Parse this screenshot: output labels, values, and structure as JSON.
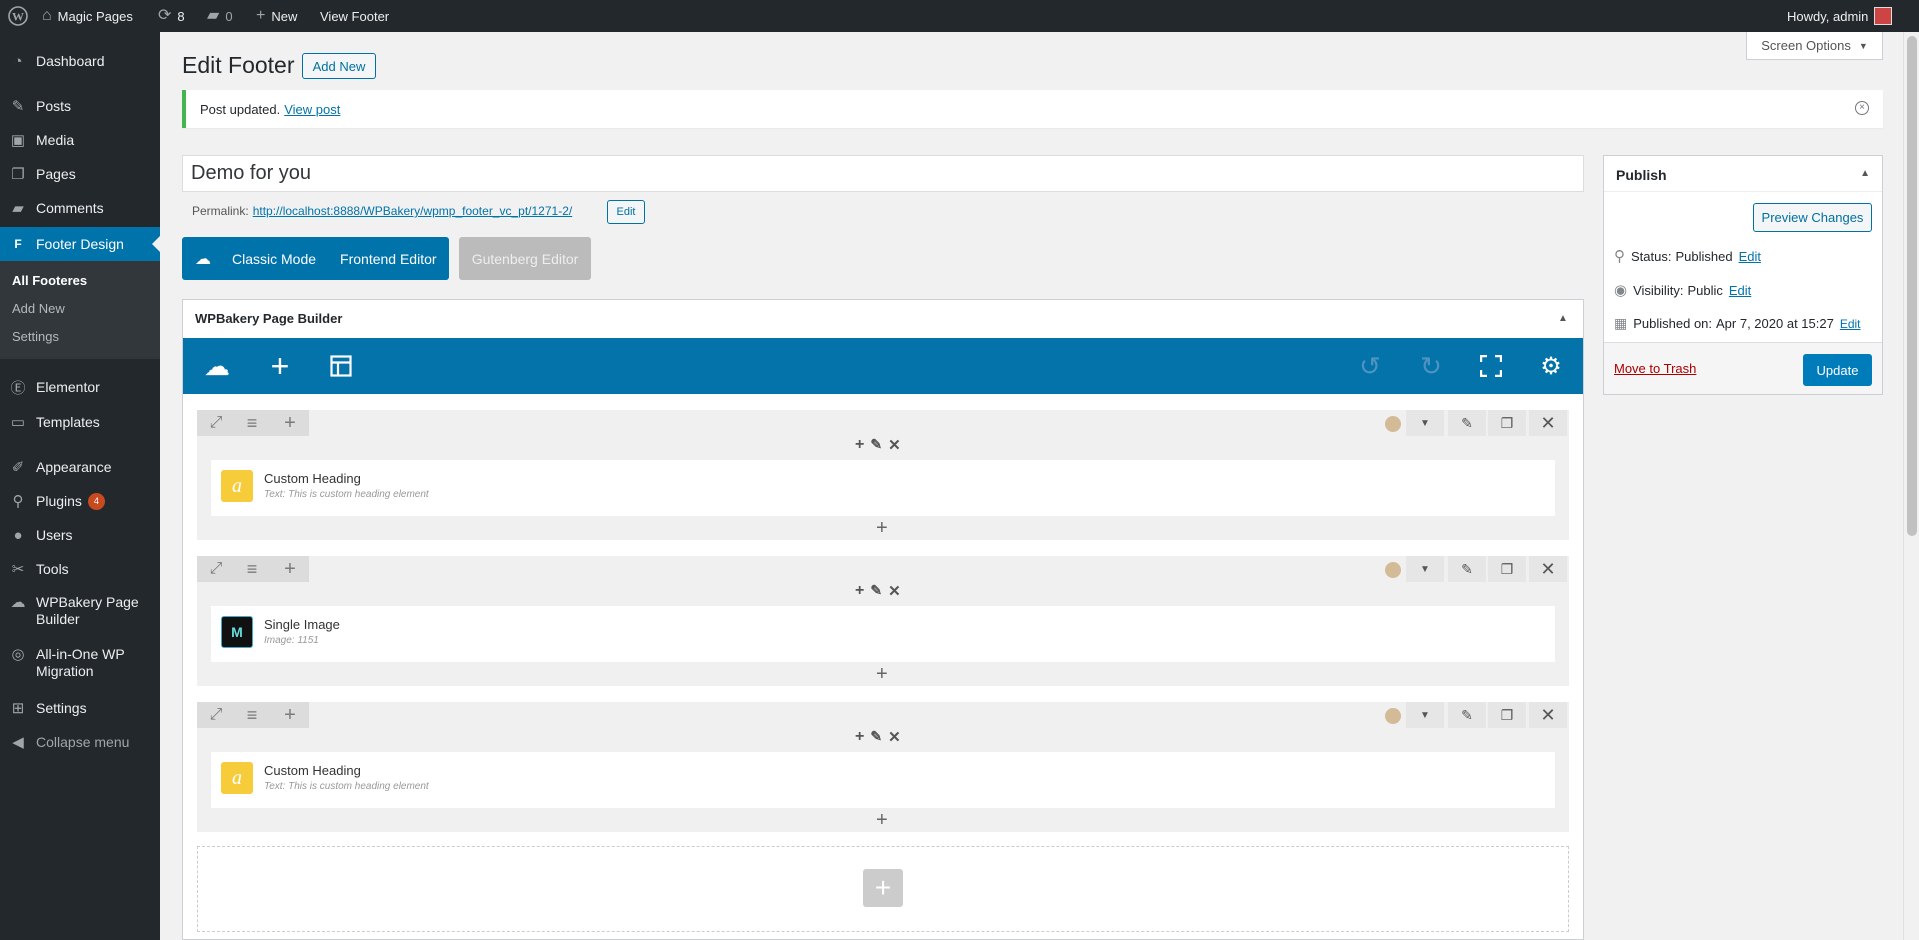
{
  "adminbar": {
    "site_name": "Magic Pages",
    "updates_count": "8",
    "comments_count": "0",
    "new_label": "New",
    "view_label": "View Footer",
    "howdy": "Howdy, admin"
  },
  "sidebar": {
    "items": [
      {
        "label": "Dashboard",
        "icon": "dashboard-icon"
      },
      {
        "label": "Posts",
        "icon": "pin-icon"
      },
      {
        "label": "Media",
        "icon": "media-icon"
      },
      {
        "label": "Pages",
        "icon": "pages-icon"
      },
      {
        "label": "Comments",
        "icon": "comment-icon"
      },
      {
        "label": "Footer Design",
        "icon": "footer-design-icon"
      },
      {
        "label": "Elementor",
        "icon": "elementor-icon"
      },
      {
        "label": "Templates",
        "icon": "folder-icon"
      },
      {
        "label": "Appearance",
        "icon": "brush-icon"
      },
      {
        "label": "Plugins",
        "icon": "plug-icon",
        "badge": "4"
      },
      {
        "label": "Users",
        "icon": "user-icon"
      },
      {
        "label": "Tools",
        "icon": "wrench-icon"
      },
      {
        "label": "WPBakery Page Builder",
        "icon": "cloud-icon"
      },
      {
        "label": "All-in-One WP Migration",
        "icon": "migration-icon"
      },
      {
        "label": "Settings",
        "icon": "settings-icon"
      },
      {
        "label": "Collapse menu",
        "icon": "collapse-icon"
      }
    ],
    "submenu": [
      "All Footeres",
      "Add New",
      "Settings"
    ]
  },
  "header": {
    "title": "Edit Footer",
    "add_new": "Add New",
    "screen_options": "Screen Options"
  },
  "notice": {
    "text": "Post updated.",
    "link": "View post"
  },
  "post": {
    "title": "Demo for you",
    "permalink_label": "Permalink:",
    "permalink_url": "http://localhost:8888/WPBakery/wpmp_footer_vc_pt/1271-2/",
    "permalink_edit": "Edit"
  },
  "editor_buttons": {
    "classic": "Classic Mode",
    "frontend": "Frontend Editor",
    "gutenberg": "Gutenberg Editor"
  },
  "builder": {
    "title": "WPBakery Page Builder",
    "rows": [
      {
        "element_title": "Custom Heading",
        "element_sub": "Text: This is custom heading element",
        "icon": "custom-heading-icon",
        "icon_text": "a"
      },
      {
        "element_title": "Single Image",
        "element_sub": "Image: 1151",
        "icon": "single-image-icon",
        "icon_text": ""
      },
      {
        "element_title": "Custom Heading",
        "element_sub": "Text: This is custom heading element",
        "icon": "custom-heading-icon",
        "icon_text": "a"
      }
    ]
  },
  "publish": {
    "title": "Publish",
    "preview": "Preview Changes",
    "status_label": "Status:",
    "status_value": "Published",
    "visibility_label": "Visibility:",
    "visibility_value": "Public",
    "published_label": "Published on:",
    "published_value": "Apr 7, 2020 at 15:27",
    "edit": "Edit",
    "trash": "Move to Trash",
    "update": "Update"
  }
}
